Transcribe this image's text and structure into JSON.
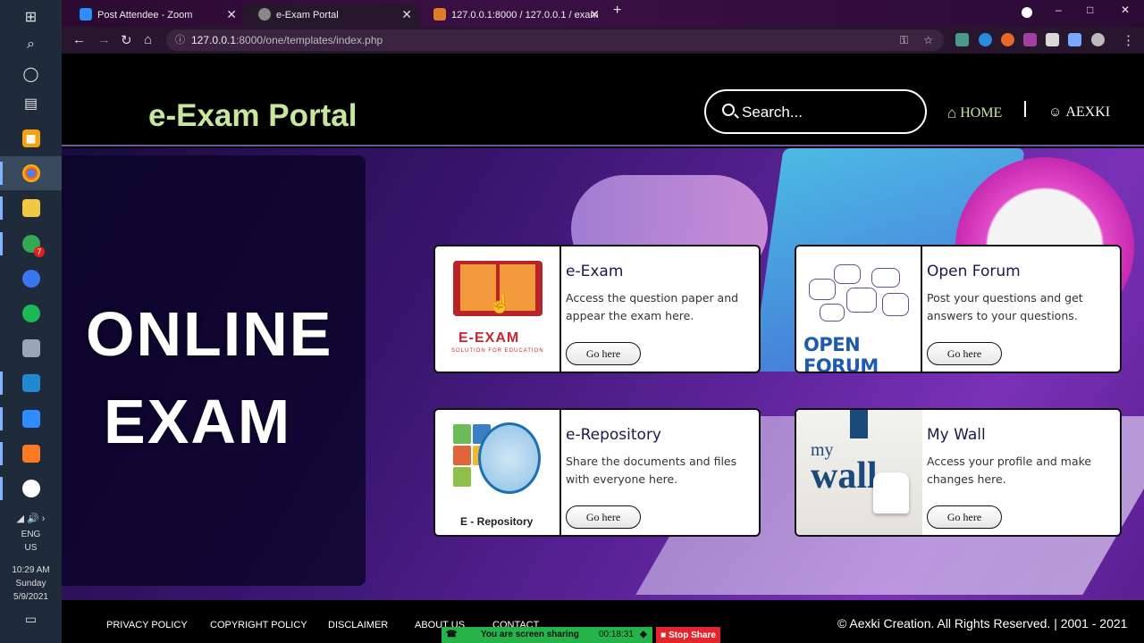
{
  "taskbar": {
    "tray": {
      "language": "ENG",
      "region": "US",
      "time": "10:29 AM",
      "day": "Sunday",
      "date": "5/9/2021"
    },
    "chat_badge": "7"
  },
  "browser": {
    "tabs": [
      {
        "title": "Post Attendee - Zoom"
      },
      {
        "title": "e-Exam Portal"
      },
      {
        "title": "127.0.0.1:8000 / 127.0.0.1 / exam"
      }
    ],
    "url_host": "127.0.0.1",
    "url_rest": ":8000/one/templates/index.php"
  },
  "header": {
    "title": "e-Exam Portal",
    "search_placeholder": "Search...",
    "nav_home": "HOME",
    "nav_user": "AEXKI"
  },
  "hero": {
    "line1": "ONLINE",
    "line2": "EXAM"
  },
  "cards": [
    {
      "title": "e-Exam",
      "text": "Access the question paper and appear the exam here.",
      "button": "Go here",
      "thumb_label": "E-EXAM",
      "thumb_sub": "SOLUTION FOR EDUCATION"
    },
    {
      "title": "Open Forum",
      "text": "Post your questions and get answers to your questions.",
      "button": "Go here",
      "thumb_label": "OPEN FORUM"
    },
    {
      "title": "e-Repository",
      "text": "Share the documents and files with everyone here.",
      "button": "Go here",
      "thumb_label": "E - Repository"
    },
    {
      "title": "My Wall",
      "text": "Access your profile and make changes here.",
      "button": "Go here",
      "thumb_label_top": "my",
      "thumb_label_bottom": "wall"
    }
  ],
  "footer": {
    "links": [
      "PRIVACY POLICY",
      "COPYRIGHT POLICY",
      "DISCLAIMER",
      "ABOUT US",
      "CONTACT"
    ],
    "copyright": "© Aexki Creation. All Rights Reserved. | 2001 - 2021"
  },
  "zoom": {
    "sharing_text": "You are screen sharing",
    "timer": "00:18:31",
    "stop_label": "Stop Share"
  },
  "colors": {
    "title_accent": "#c9e79c",
    "card_title": "#1a1a4a",
    "hero_purple": "#5b2398",
    "stop_red": "#e3262e",
    "share_green": "#25b34a"
  }
}
